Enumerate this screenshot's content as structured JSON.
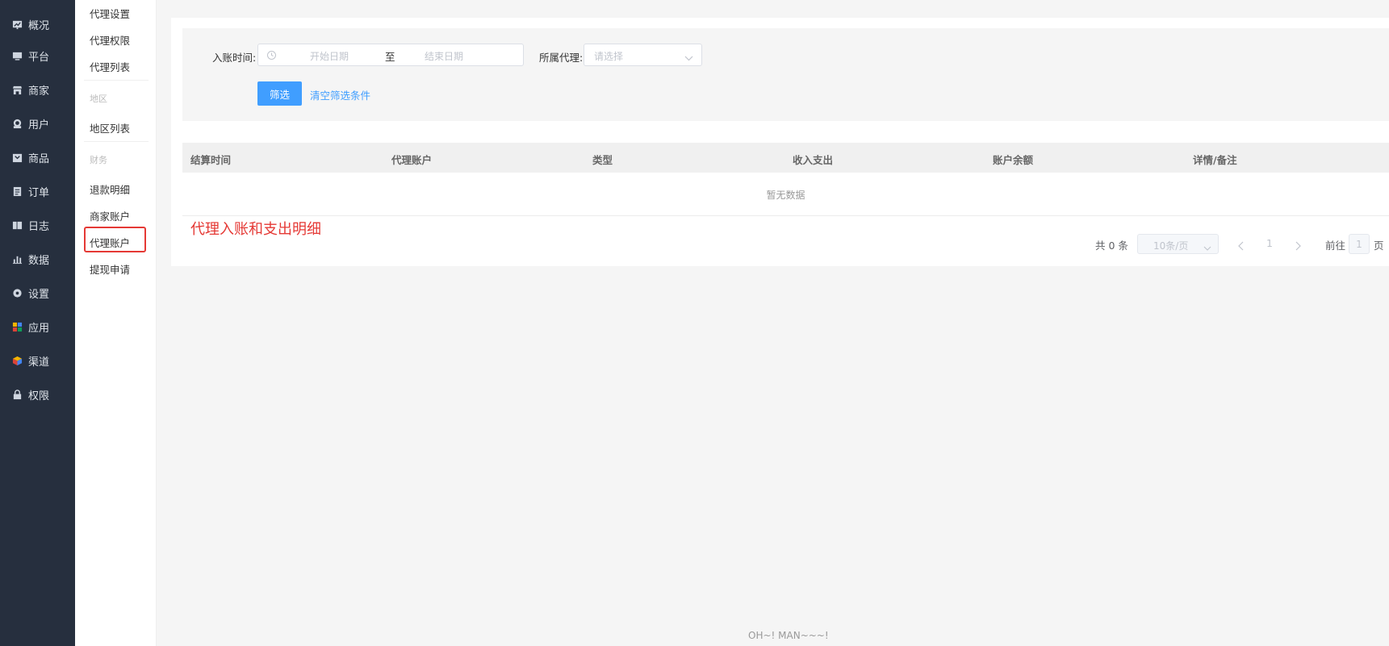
{
  "nav": {
    "items": [
      {
        "label": "概况",
        "icon": "chart-board-icon"
      },
      {
        "label": "平台",
        "icon": "monitor-icon"
      },
      {
        "label": "商家",
        "icon": "store-icon"
      },
      {
        "label": "用户",
        "icon": "user-icon"
      },
      {
        "label": "商品",
        "icon": "goods-icon"
      },
      {
        "label": "订单",
        "icon": "order-icon"
      },
      {
        "label": "日志",
        "icon": "log-icon"
      },
      {
        "label": "数据",
        "icon": "bar-chart-icon"
      },
      {
        "label": "设置",
        "icon": "gear-icon"
      },
      {
        "label": "应用",
        "icon": "apps-grid-icon"
      },
      {
        "label": "渠道",
        "icon": "cube-icon"
      },
      {
        "label": "权限",
        "icon": "lock-icon"
      }
    ]
  },
  "submenu": {
    "items": [
      {
        "label": "代理设置"
      },
      {
        "label": "代理权限"
      },
      {
        "label": "代理列表"
      },
      {
        "label": "地区列表"
      },
      {
        "label": "退款明细"
      },
      {
        "label": "商家账户"
      },
      {
        "label": "代理账户"
      },
      {
        "label": "提现申请"
      }
    ],
    "groups": [
      "地区",
      "财务"
    ],
    "active": "代理账户"
  },
  "filter": {
    "time_label": "入账时间:",
    "start_placeholder": "开始日期",
    "range_sep": "至",
    "end_placeholder": "结束日期",
    "agent_label": "所属代理:",
    "agent_placeholder": "请选择",
    "filter_button": "筛选",
    "clear_link": "清空筛选条件"
  },
  "table": {
    "columns": [
      "结算时间",
      "代理账户",
      "类型",
      "收入支出",
      "账户余额",
      "详情/备注"
    ],
    "empty_text": "暂无数据"
  },
  "annotation": "代理入账和支出明细",
  "pagination": {
    "total": "共 0 条",
    "page_size": "10条/页",
    "current_page": "1",
    "goto_label": "前往",
    "goto_value": "1",
    "page_unit": "页"
  },
  "footer": "OH~! MAN~~~!",
  "colors": {
    "nav_bg": "#262f3e",
    "primary": "#409eff",
    "annotation": "#e53935"
  }
}
